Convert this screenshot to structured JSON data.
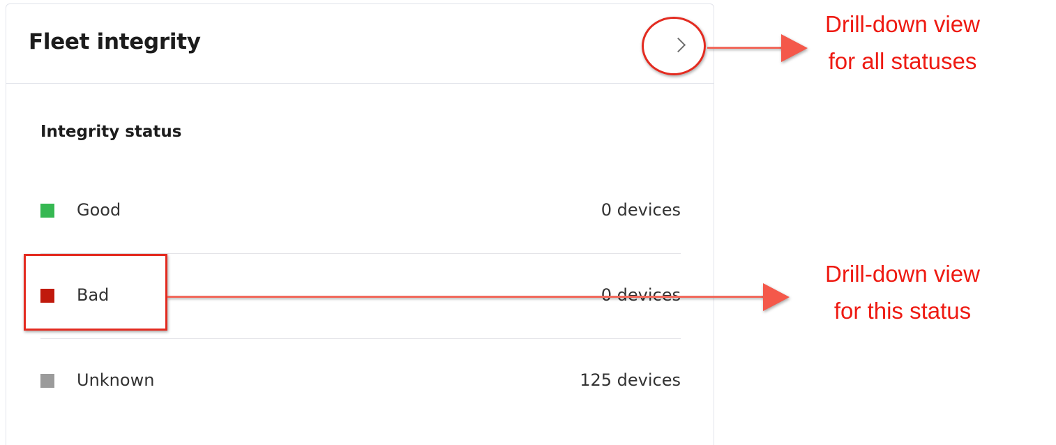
{
  "card": {
    "title": "Fleet integrity",
    "section_title": "Integrity status"
  },
  "statuses": [
    {
      "label": "Good",
      "count": "0 devices",
      "color": "#36b852"
    },
    {
      "label": "Bad",
      "count": "0 devices",
      "color": "#c0190c"
    },
    {
      "label": "Unknown",
      "count": "125 devices",
      "color": "#9b9b9b"
    }
  ],
  "annotations": {
    "all_statuses": {
      "line1": "Drill-down view",
      "line2": "for all statuses"
    },
    "this_status": {
      "line1": "Drill-down view",
      "line2": "for this status"
    },
    "color": "#ee1a12"
  }
}
